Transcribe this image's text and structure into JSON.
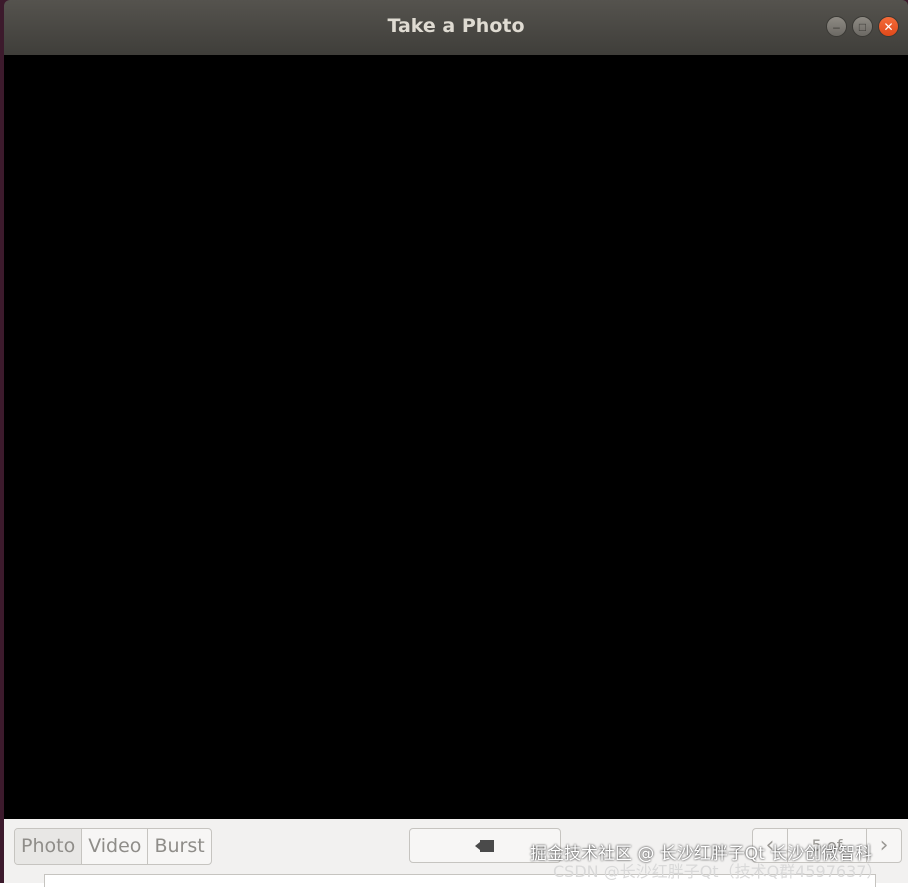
{
  "window": {
    "title": "Take a Photo",
    "controls": {
      "minimize_icon": "–",
      "maximize_icon": "□",
      "close_icon": "✕"
    }
  },
  "viewfinder": {
    "background": "#000000"
  },
  "toolbar": {
    "modes": [
      {
        "label": "Photo",
        "active": true
      },
      {
        "label": "Video",
        "active": false
      },
      {
        "label": "Burst",
        "active": false
      }
    ],
    "capture_icon": "camera-icon",
    "nav": {
      "prev_icon": "‹",
      "next_icon": "›",
      "count": "5 of"
    }
  },
  "watermark": {
    "line1": "掘金技术社区 @ 长沙红胖子Qt 长沙创微智科",
    "line2": "CSDN @长沙红胖子Qt（技术Q群4597637）"
  },
  "colors": {
    "titlebar": "#3f3e3a",
    "close_button": "#e0491a",
    "toolbar_bg": "#f2f1f0"
  }
}
